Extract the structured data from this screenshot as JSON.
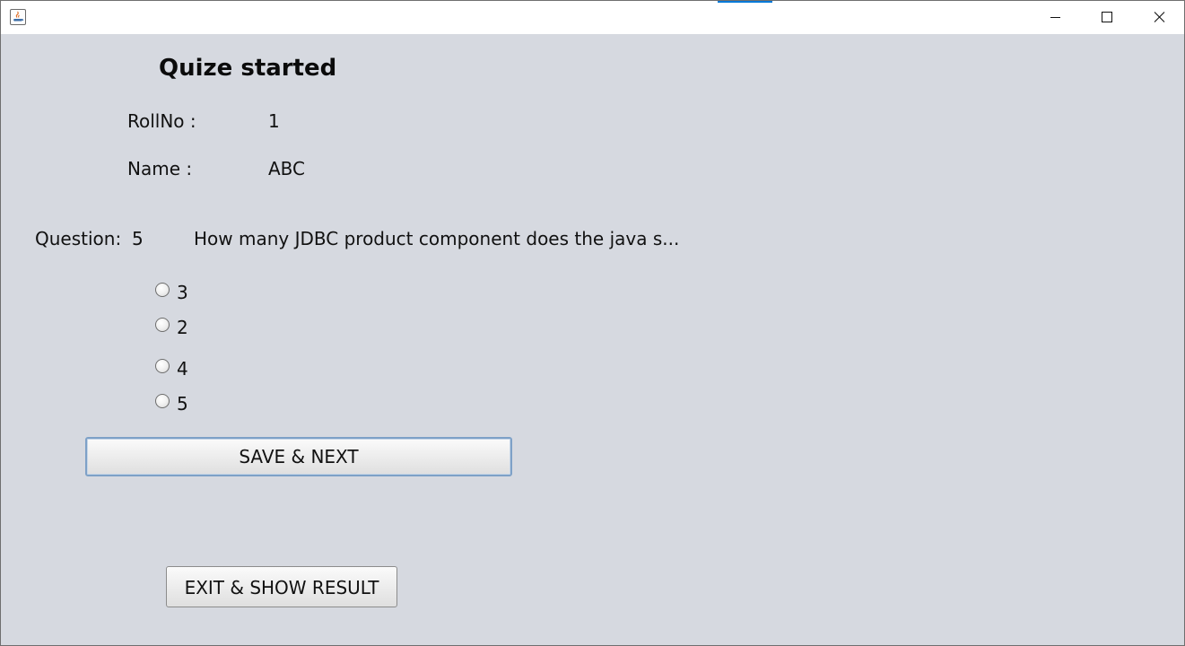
{
  "window": {
    "title_icon": "java-icon",
    "controls": [
      "minimize-icon",
      "maximize-icon",
      "close-icon"
    ]
  },
  "quiz": {
    "heading": "Quize started",
    "rollno_label": "RollNo :",
    "rollno_value": "1",
    "name_label": "Name :",
    "name_value": "ABC",
    "question_label": "Question:",
    "question_number": "5",
    "question_text": "How many JDBC product component does the java s...",
    "options": [
      "3",
      "2",
      "4",
      "5"
    ],
    "selected_option": null
  },
  "buttons": {
    "save_next": "SAVE & NEXT",
    "exit_result": "EXIT & SHOW RESULT"
  },
  "colors": {
    "background": "#d6d9e0",
    "focus_border": "#7ea1c7",
    "titlebar": "#ffffff"
  }
}
